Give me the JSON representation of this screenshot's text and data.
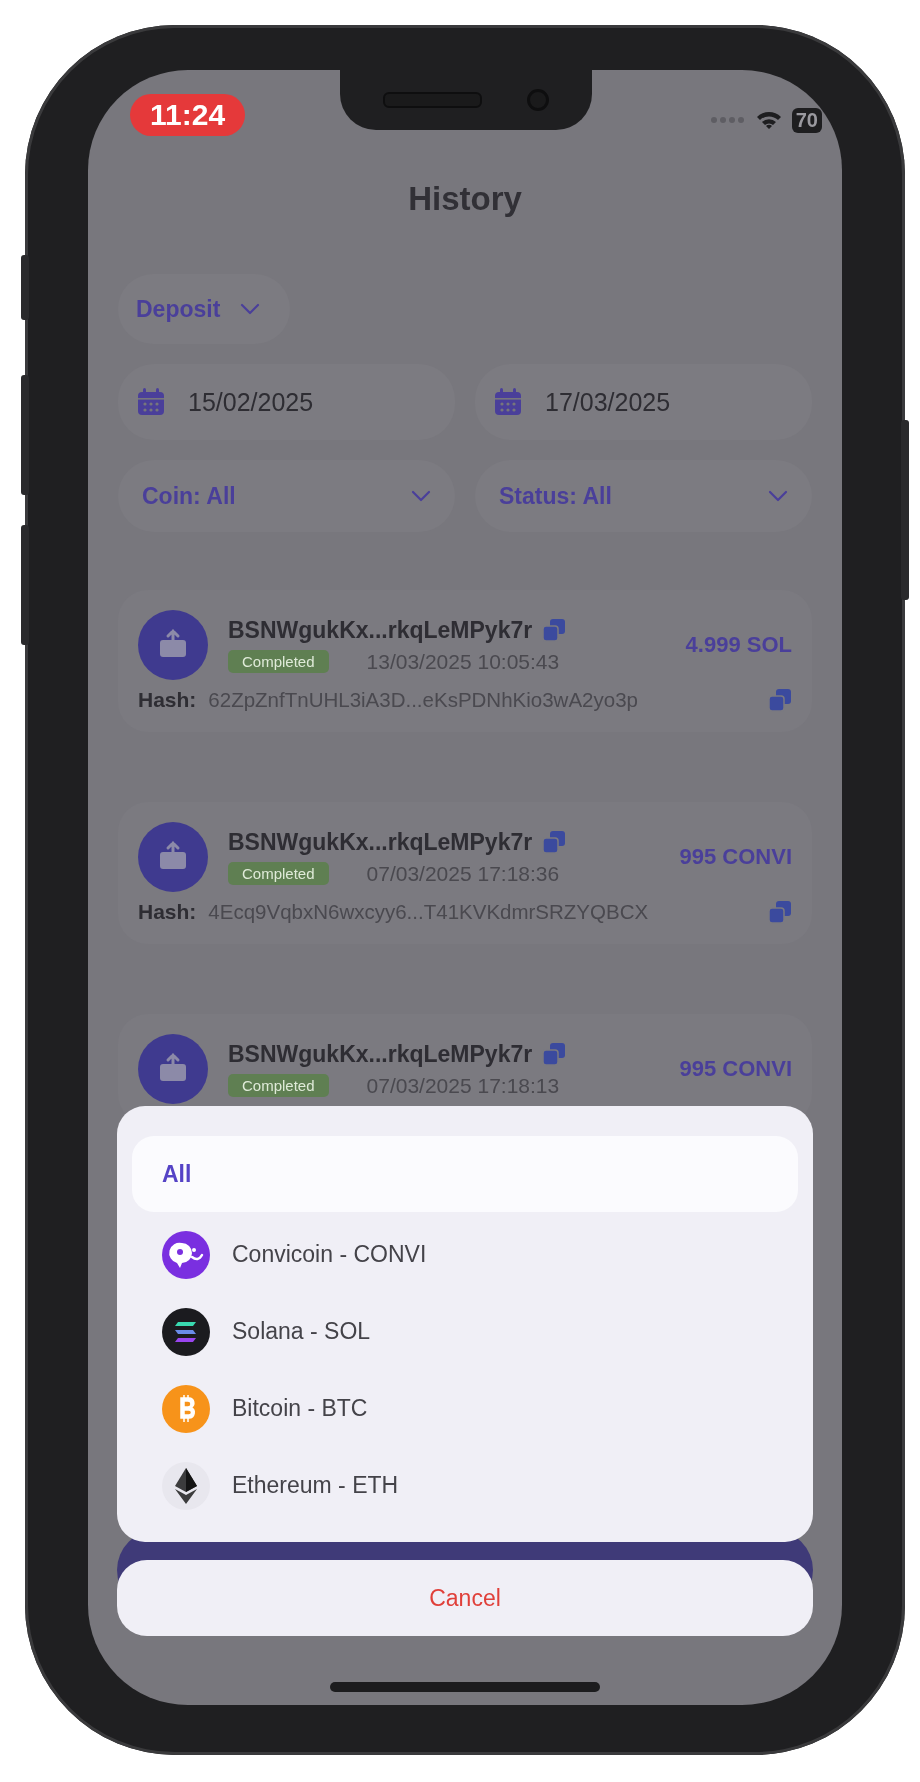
{
  "status_bar": {
    "time": "11:24",
    "battery": "70"
  },
  "title": "History",
  "type_filter": {
    "value": "Deposit"
  },
  "date_from": {
    "value": "15/02/2025"
  },
  "date_to": {
    "value": "17/03/2025"
  },
  "coin_filter": {
    "value": "Coin: All"
  },
  "status_filter": {
    "value": "Status: All"
  },
  "transactions": [
    {
      "address": "BSNWgukKx...rkqLeMPyk7r",
      "status": "Completed",
      "datetime": "13/03/2025 10:05:43",
      "amount": "4.999 SOL",
      "hash_label": "Hash:",
      "hash": "62ZpZnfTnUHL3iA3D...eKsPDNhKio3wA2yo3p"
    },
    {
      "address": "BSNWgukKx...rkqLeMPyk7r",
      "status": "Completed",
      "datetime": "07/03/2025 17:18:36",
      "amount": "995 CONVI",
      "hash_label": "Hash:",
      "hash": "4Ecq9VqbxN6wxcyy6...T41KVKdmrSRZYQBCX"
    },
    {
      "address": "BSNWgukKx...rkqLeMPyk7r",
      "status": "Completed",
      "datetime": "07/03/2025 17:18:13",
      "amount": "995 CONVI"
    }
  ],
  "coin_sheet": {
    "options": [
      {
        "label": "All",
        "kind": "text",
        "selected": true
      },
      {
        "label": "Convicoin - CONVI",
        "kind": "convicoin",
        "selected": false
      },
      {
        "label": "Solana - SOL",
        "kind": "solana",
        "selected": false
      },
      {
        "label": "Bitcoin - BTC",
        "kind": "bitcoin",
        "selected": false
      },
      {
        "label": "Ethereum - ETH",
        "kind": "ethereum",
        "selected": false
      }
    ],
    "cancel": "Cancel"
  }
}
